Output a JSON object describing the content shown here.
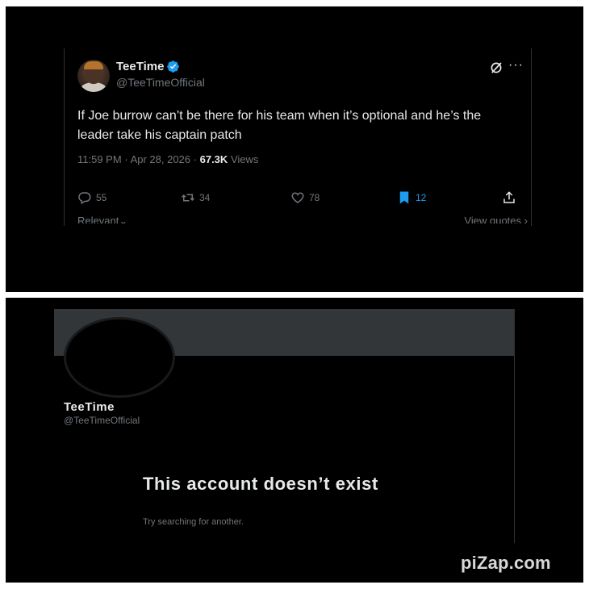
{
  "tweet": {
    "display_name": "TeeTime",
    "handle": "@TeeTimeOfficial",
    "text": "If Joe burrow can’t be there for his team when it’s optional and he’s the leader take his captain patch",
    "time": "11:59 PM",
    "separator": "·",
    "date": "Apr 28, 2026",
    "views_count": "67.3K",
    "views_label": "Views",
    "icons": {
      "verified": "verified-badge-icon",
      "grok": "grok-icon",
      "more": "more-icon",
      "reply": "reply-icon",
      "retweet": "retweet-icon",
      "like": "like-icon",
      "bookmark": "bookmark-icon",
      "share": "share-icon"
    },
    "actions": {
      "replies": "55",
      "reposts": "34",
      "likes": "78",
      "bookmarks": "12"
    },
    "sort_label": "Relevant",
    "view_quotes_label": "View quotes",
    "colors": {
      "accent": "#1d9bf0",
      "text": "#e7e9ea",
      "muted": "#71767b",
      "background": "#000000"
    }
  },
  "profile": {
    "display_name": "TeeTime",
    "handle": "@TeeTimeOfficial",
    "empty_title": "This account doesn’t exist",
    "empty_subtitle": "Try searching for another.",
    "banner_color": "#333639"
  },
  "watermark": "piZap.com"
}
